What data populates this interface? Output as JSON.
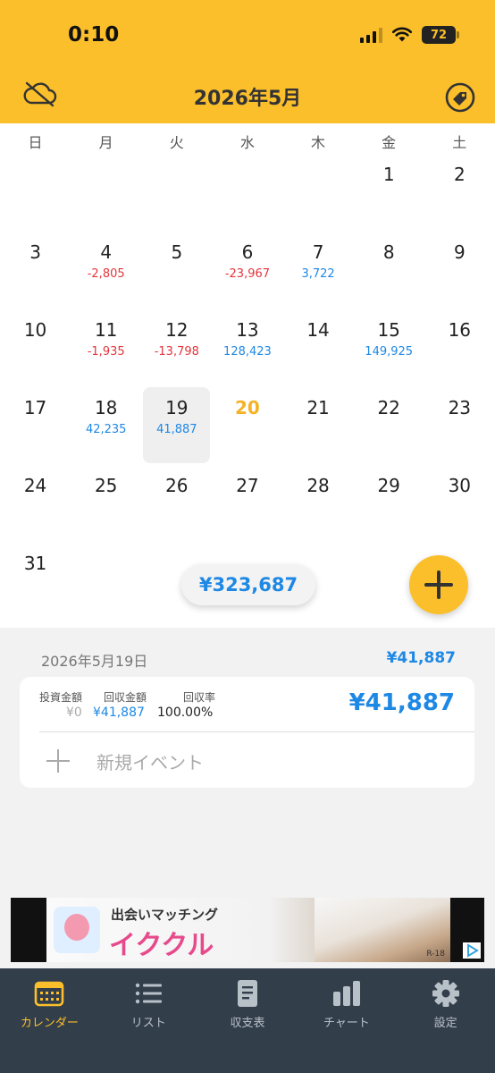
{
  "status_bar": {
    "time": "0:10",
    "battery": "72"
  },
  "header": {
    "title": "2026年5月",
    "left_icon": "cloud-off-icon",
    "right_icon": "tag-icon"
  },
  "calendar": {
    "weekdays": [
      "日",
      "月",
      "火",
      "水",
      "木",
      "金",
      "土"
    ],
    "weeks": [
      [
        {
          "day": "",
          "amount": ""
        },
        {
          "day": "",
          "amount": ""
        },
        {
          "day": "",
          "amount": ""
        },
        {
          "day": "",
          "amount": ""
        },
        {
          "day": "",
          "amount": ""
        },
        {
          "day": "1",
          "amount": ""
        },
        {
          "day": "2",
          "amount": ""
        }
      ],
      [
        {
          "day": "3",
          "amount": ""
        },
        {
          "day": "4",
          "amount": "-2,805"
        },
        {
          "day": "5",
          "amount": ""
        },
        {
          "day": "6",
          "amount": "-23,967"
        },
        {
          "day": "7",
          "amount": "3,722"
        },
        {
          "day": "8",
          "amount": ""
        },
        {
          "day": "9",
          "amount": ""
        }
      ],
      [
        {
          "day": "10",
          "amount": ""
        },
        {
          "day": "11",
          "amount": "-1,935"
        },
        {
          "day": "12",
          "amount": "-13,798"
        },
        {
          "day": "13",
          "amount": "128,423"
        },
        {
          "day": "14",
          "amount": ""
        },
        {
          "day": "15",
          "amount": "149,925"
        },
        {
          "day": "16",
          "amount": ""
        }
      ],
      [
        {
          "day": "17",
          "amount": ""
        },
        {
          "day": "18",
          "amount": "42,235"
        },
        {
          "day": "19",
          "amount": "41,887",
          "selected": true
        },
        {
          "day": "20",
          "amount": "",
          "today": true
        },
        {
          "day": "21",
          "amount": ""
        },
        {
          "day": "22",
          "amount": ""
        },
        {
          "day": "23",
          "amount": ""
        }
      ],
      [
        {
          "day": "24",
          "amount": ""
        },
        {
          "day": "25",
          "amount": ""
        },
        {
          "day": "26",
          "amount": ""
        },
        {
          "day": "27",
          "amount": ""
        },
        {
          "day": "28",
          "amount": ""
        },
        {
          "day": "29",
          "amount": ""
        },
        {
          "day": "30",
          "amount": ""
        }
      ],
      [
        {
          "day": "31",
          "amount": ""
        },
        {
          "day": "",
          "amount": ""
        },
        {
          "day": "",
          "amount": ""
        },
        {
          "day": "",
          "amount": ""
        },
        {
          "day": "",
          "amount": ""
        },
        {
          "day": "",
          "amount": ""
        },
        {
          "day": "",
          "amount": ""
        }
      ]
    ],
    "month_total": "¥323,687"
  },
  "colors": {
    "accent": "#fbbf2b",
    "positive": "#1e88e5",
    "negative": "#e2363c",
    "tabbar": "#333e4b"
  },
  "detail": {
    "date": "2026年5月19日",
    "total": "¥41,887",
    "investment_label": "投資金額",
    "investment_value": "¥0",
    "return_label": "回収金額",
    "return_value": "¥41,887",
    "rate_label": "回収率",
    "rate_value": "100.00%",
    "big_amount": "¥41,887",
    "new_event": "新規イベント"
  },
  "ad": {
    "title": "出会いマッチング",
    "brand": "イククル",
    "rating": "R-18"
  },
  "tabs": [
    {
      "label": "カレンダー",
      "icon": "calendar-icon",
      "active": true
    },
    {
      "label": "リスト",
      "icon": "list-icon"
    },
    {
      "label": "収支表",
      "icon": "document-icon"
    },
    {
      "label": "チャート",
      "icon": "bar-chart-icon"
    },
    {
      "label": "設定",
      "icon": "gear-icon"
    }
  ]
}
